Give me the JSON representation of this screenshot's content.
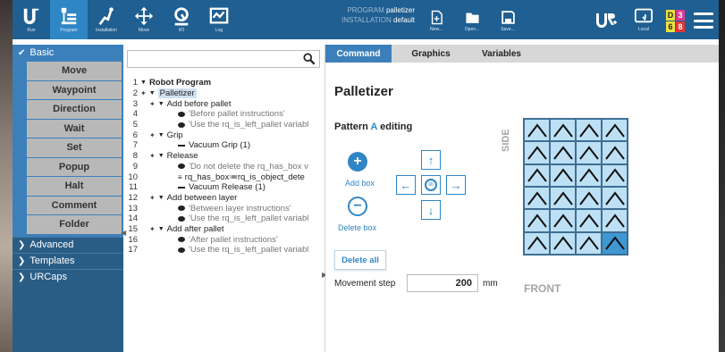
{
  "topbar": {
    "items": [
      {
        "label": "Run",
        "icon": "ur-logo-icon"
      },
      {
        "label": "Program",
        "icon": "program-icon"
      },
      {
        "label": "Installation",
        "icon": "installation-icon"
      },
      {
        "label": "Move",
        "icon": "move-icon"
      },
      {
        "label": "I/O",
        "icon": "io-icon"
      },
      {
        "label": "Log",
        "icon": "log-icon"
      }
    ],
    "program_label": "PROGRAM",
    "program_value": "palletizer",
    "installation_label": "INSTALLATION",
    "installation_value": "default",
    "new_label": "New...",
    "open_label": "Open...",
    "save_label": "Save...",
    "local_label": "Local",
    "status": [
      "D",
      "3",
      "6",
      "8"
    ],
    "accent": "#2f86c5"
  },
  "sidebar": {
    "basic_label": "Basic",
    "items": [
      "Move",
      "Waypoint",
      "Direction",
      "Wait",
      "Set",
      "Popup",
      "Halt",
      "Comment",
      "Folder"
    ],
    "advanced_label": "Advanced",
    "templates_label": "Templates",
    "urcaps_label": "URCaps"
  },
  "tree": {
    "lines": [
      {
        "n": "1",
        "text": "Robot Program"
      },
      {
        "n": "2",
        "text": "Palletizer"
      },
      {
        "n": "3",
        "text": "Add before pallet"
      },
      {
        "n": "4",
        "text": "'Before pallet instructions'"
      },
      {
        "n": "5",
        "text": "'Use the rq_is_left_pallet variabl"
      },
      {
        "n": "6",
        "text": "Grip"
      },
      {
        "n": "7",
        "text": "Vacuum Grip  (1)"
      },
      {
        "n": "8",
        "text": "Release"
      },
      {
        "n": "9",
        "text": "'Do not delete the rq_has_box v"
      },
      {
        "n": "10",
        "text": "rq_has_box≔rq_is_object_dete"
      },
      {
        "n": "11",
        "text": "Vacuum Release  (1)"
      },
      {
        "n": "12",
        "text": "Add between layer"
      },
      {
        "n": "13",
        "text": "'Between layer instructions'"
      },
      {
        "n": "14",
        "text": "'Use the rq_is_left_pallet variabl"
      },
      {
        "n": "15",
        "text": "Add after pallet"
      },
      {
        "n": "16",
        "text": "'After pallet instructions'"
      },
      {
        "n": "17",
        "text": "'Use the rq_is_left_pallet variabl"
      }
    ]
  },
  "panel": {
    "tabs": [
      "Command",
      "Graphics",
      "Variables"
    ],
    "title": "Palletizer",
    "pattern_prefix": "Pattern ",
    "pattern_letter": "A",
    "pattern_suffix": " editing",
    "add_box": "Add box",
    "delete_box": "Delete box",
    "delete_all": "Delete all",
    "movement_step_label": "Movement step",
    "movement_step_value": "200",
    "movement_step_unit": "mm",
    "side_label": "SIDE",
    "front_label": "FRONT",
    "grid_rows": 6,
    "grid_cols": 4,
    "active_cell": "row 6, col 4"
  }
}
